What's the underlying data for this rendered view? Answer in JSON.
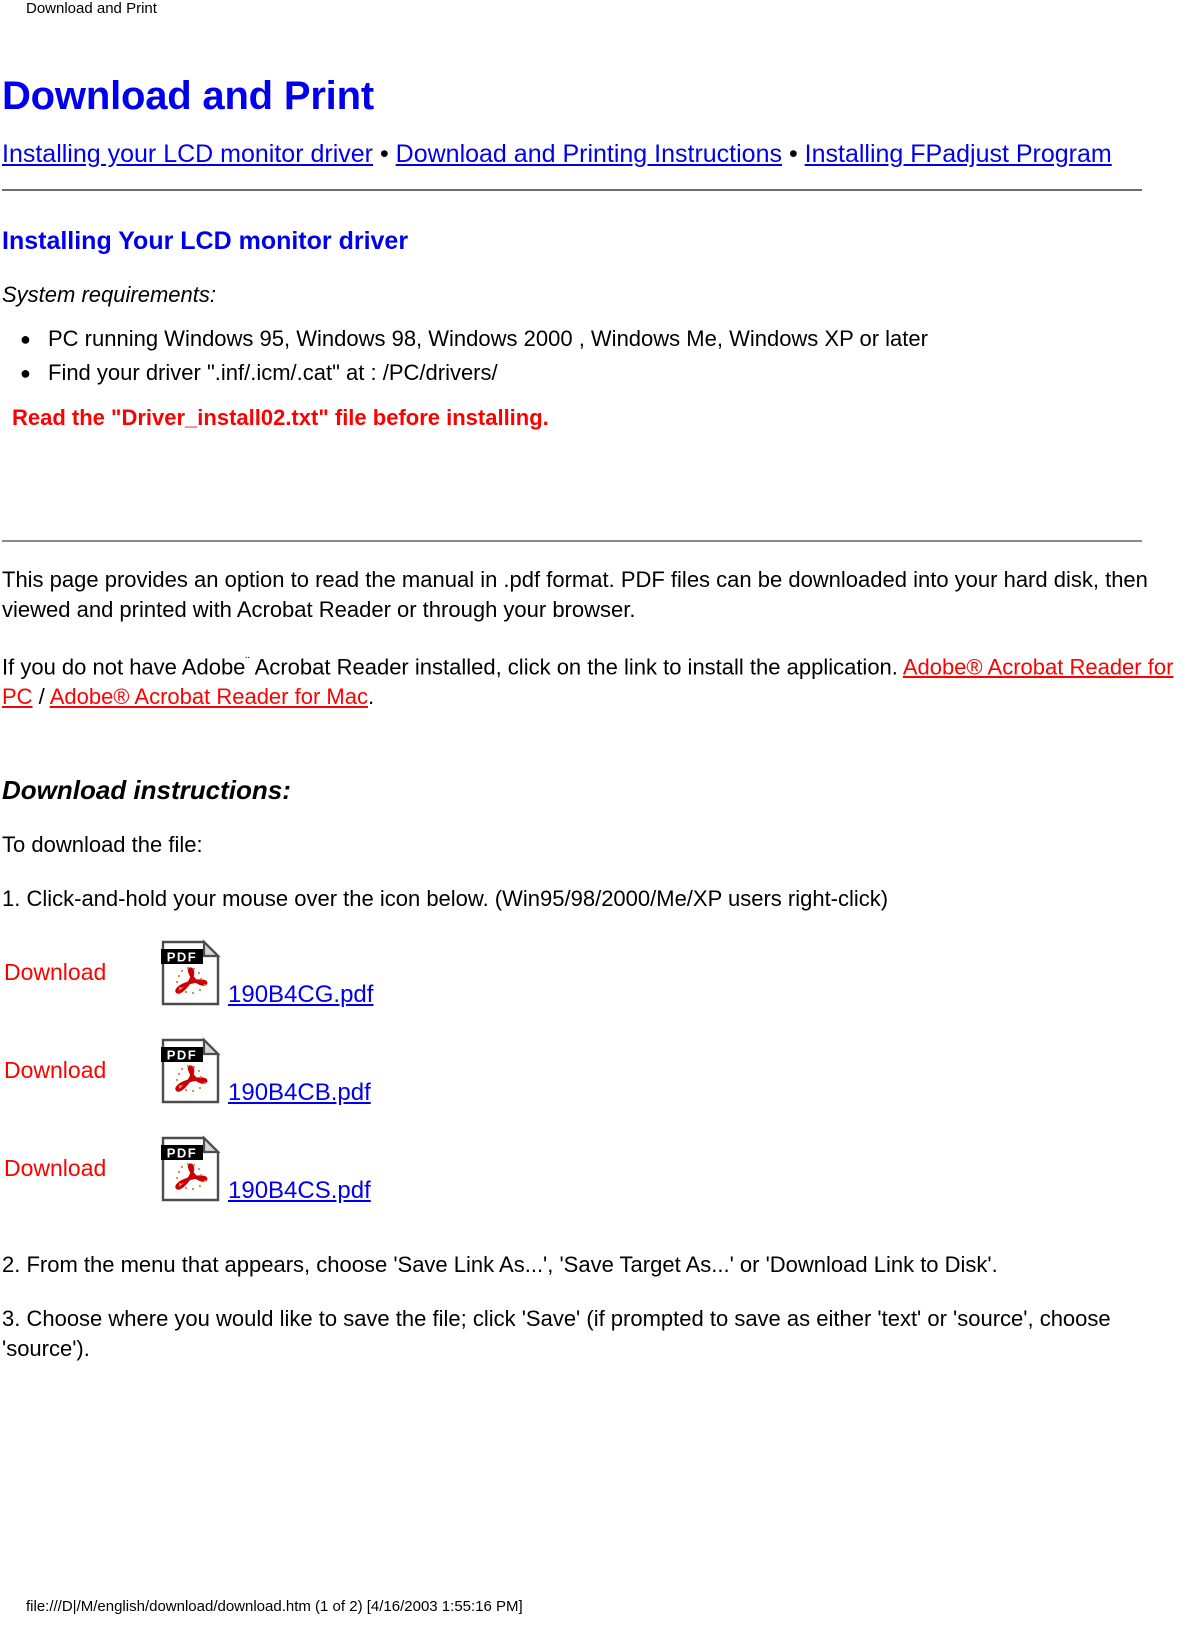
{
  "browser_header": {
    "title": "Download and Print"
  },
  "page": {
    "title": "Download and Print"
  },
  "nav": {
    "links": [
      {
        "label": "Installing your LCD monitor driver"
      },
      {
        "label": "Download and Printing Instructions"
      },
      {
        "label": "Installing FPadjust Program"
      }
    ],
    "separator": "•"
  },
  "driver_section": {
    "heading": "Installing Your LCD monitor driver",
    "sys_req_label": "System requirements:",
    "requirements": [
      "PC running Windows 95, Windows 98, Windows 2000 , Windows Me, Windows XP or later",
      "Find your driver \".inf/.icm/.cat\" at : /PC/drivers/"
    ],
    "bullet_glyph": "●",
    "warning": "Read the \"Driver_install02.txt\" file before installing."
  },
  "pdf_section": {
    "paragraph1": "This page provides an option to read the manual in .pdf format. PDF files can be downloaded into your hard disk, then viewed and printed with Acrobat Reader or through your browser.",
    "paragraph2_pre": "If you do not have Adobe",
    "paragraph2_tm": "¨",
    "paragraph2_mid": " Acrobat Reader installed, click on the link to install the application. ",
    "link_pc": "Adobe® Acrobat Reader for PC",
    "separator": " / ",
    "link_mac": "Adobe® Acrobat Reader for Mac",
    "paragraph2_end": "."
  },
  "download_section": {
    "heading": "Download instructions:",
    "intro": "To download the file:",
    "step1": "1. Click-and-hold your mouse over the icon below. (Win95/98/2000/Me/XP users right-click)",
    "step2": "2. From the menu that appears, choose 'Save Link As...', 'Save Target As...' or 'Download Link to Disk'.",
    "step3": "3. Choose where you would like to save the file; click 'Save' (if prompted to save as either 'text' or 'source', choose 'source').",
    "items": [
      {
        "label": "Download",
        "icon": "pdf-file-icon",
        "file": "190B4CG.pdf"
      },
      {
        "label": "Download",
        "icon": "pdf-file-icon",
        "file": "190B4CB.pdf"
      },
      {
        "label": "Download",
        "icon": "pdf-file-icon",
        "file": "190B4CS.pdf"
      }
    ]
  },
  "footer": {
    "text": "file:///D|/M/english/download/download.htm (1 of 2) [4/16/2003 1:55:16 PM]"
  },
  "colors": {
    "link_blue": "#0000EE",
    "link_red": "#FF0000",
    "text_black": "#000000",
    "rule_gray": "#6E6E6E",
    "pdf_icon_red": "#CC0000"
  }
}
